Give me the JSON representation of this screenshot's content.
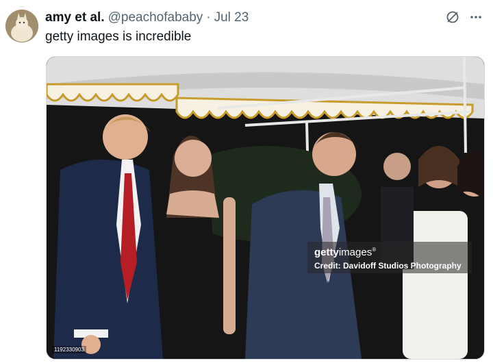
{
  "tweet": {
    "author_name": "amy et al.",
    "handle": "@peachofababy",
    "separator": "·",
    "date": "Jul 23",
    "text": "getty images is incredible"
  },
  "media": {
    "watermark_brand_bold": "getty",
    "watermark_brand_rest": "images",
    "watermark_reg": "®",
    "watermark_credit": "Credit: Davidoff Studios Photography",
    "image_id": "1192330903"
  },
  "icons": {
    "grok": "grok-icon",
    "more": "more-icon"
  },
  "colors": {
    "text_primary": "#0f1419",
    "text_secondary": "#536471"
  }
}
